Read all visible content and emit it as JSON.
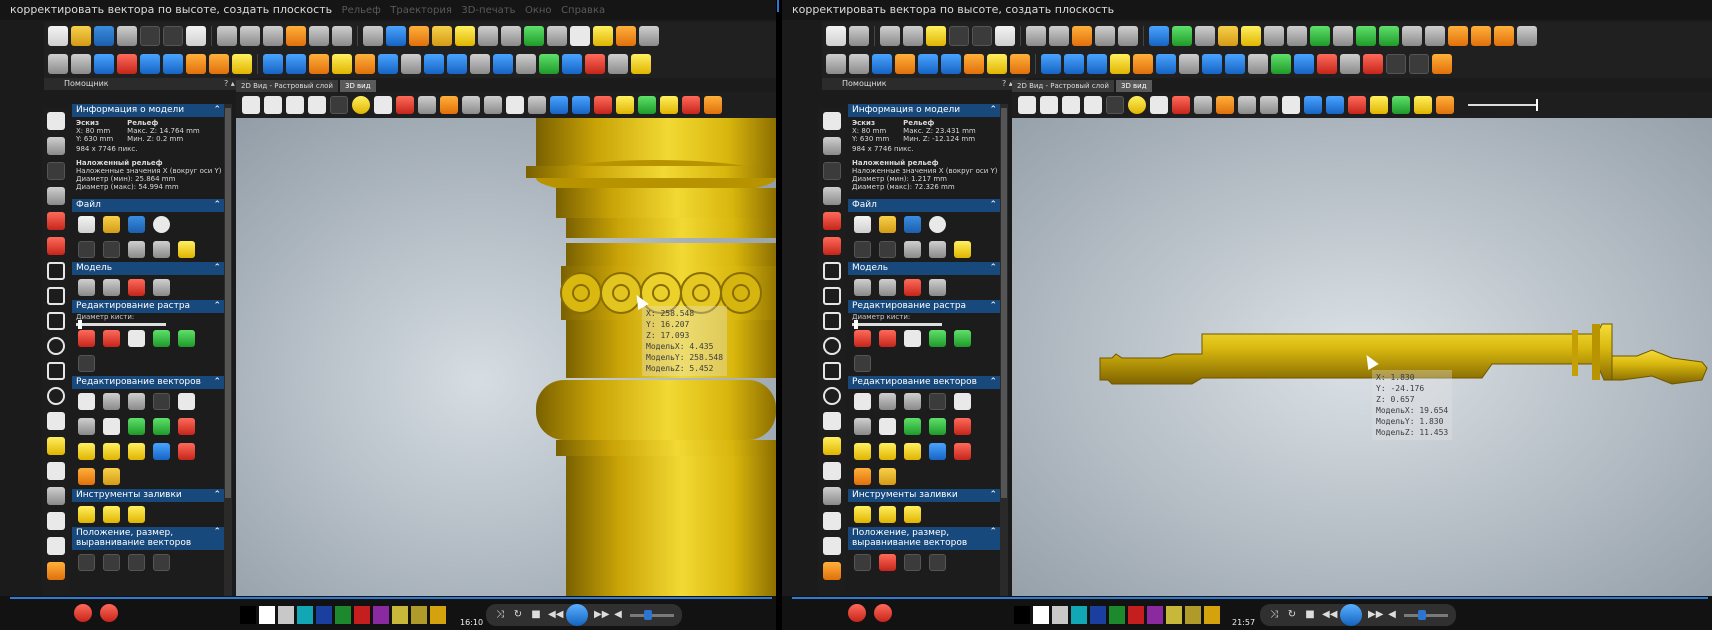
{
  "left": {
    "title": "корректировать вектора по высоте, создать плоскость",
    "menu": [
      "Рельеф",
      "Траектория",
      "3D-печать",
      "Окно",
      "Справка"
    ],
    "assistant_title": "Помощник",
    "tabs": [
      "2D Вид - Растровый слой",
      "3D вид"
    ],
    "model_info": {
      "header": "Информация о модели",
      "sketch_label": "Эскиз",
      "sketch_x": "X: 80 mm",
      "sketch_y": "Y: 630 mm",
      "relief_label": "Рельеф",
      "relief_max": "Макс. Z: 14.764 mm",
      "relief_min": "Мин. Z: 0.2 mm",
      "pixels": "984 x 7746 пикс.",
      "overlay_title": "Наложенный рельеф",
      "overlay_values": "Наложенные значения X (вокруг оси Y)",
      "diam_min": "Диаметр (мин): 25.864 mm",
      "diam_max": "Диаметр (макс): 54.994 mm"
    },
    "coords": [
      "X: 258.548",
      "Y: 16.207",
      "Z: 17.093",
      "МодельX: 4.435",
      "МодельY: 258.548",
      "МодельZ: 5.452"
    ],
    "time": "16:10"
  },
  "right": {
    "title": "корректировать вектора по высоте, создать плоскость",
    "assistant_title": "Помощник",
    "tabs": [
      "2D Вид - Растровый слой",
      "3D вид"
    ],
    "model_info": {
      "header": "Информация о модели",
      "sketch_label": "Эскиз",
      "sketch_x": "X: 80 mm",
      "sketch_y": "Y: 630 mm",
      "relief_label": "Рельеф",
      "relief_max": "Макс. Z: 23.431 mm",
      "relief_min": "Мин. Z: -12.124 mm",
      "pixels": "984 x 7746 пикс.",
      "overlay_title": "Наложенный рельеф",
      "overlay_values": "Наложенные значения X (вокруг оси Y)",
      "diam_min": "Диаметр (мин): 1.217 mm",
      "diam_max": "Диаметр (макс): 72.326 mm"
    },
    "coords": [
      "X: 1.830",
      "Y: -24.176",
      "Z: 0.657",
      "МодельX: 19.654",
      "МодельY: 1.830",
      "МодельZ: 11.453"
    ],
    "time": "21:57"
  },
  "sections": {
    "file": "Файл",
    "model": "Модель",
    "raster_edit": "Редактирование растра",
    "brush_diameter": "Диаметр кисти:",
    "vector_edit": "Редактирование векторов",
    "fill_tools": "Инструменты заливки",
    "position": "Положение, размер, выравнивание векторов"
  },
  "colors": {
    "section_header": "#18497d",
    "relief_gold": "#d4b00c",
    "viewport_bg": "#b8c4ce",
    "progress": "#2e7bd3"
  },
  "swatch_colors": [
    "#000000",
    "#ffffff",
    "#c8c8c8",
    "#11a7b5",
    "#1a3f9e",
    "#1c8a2c",
    "#c41e1e",
    "#8b2aa0",
    "#c8b83a",
    "#b09a2a",
    "#d4a20c"
  ],
  "icons": {
    "toolbar": [
      "new-file-icon",
      "open-folder-icon",
      "save-icon",
      "print-icon",
      "undo-icon",
      "redo-icon",
      "cut-icon",
      "copy-icon",
      "paste-icon"
    ],
    "player": [
      "shuffle-icon",
      "repeat-icon",
      "stop-icon",
      "prev-icon",
      "play-icon",
      "next-icon",
      "volume-icon"
    ]
  }
}
